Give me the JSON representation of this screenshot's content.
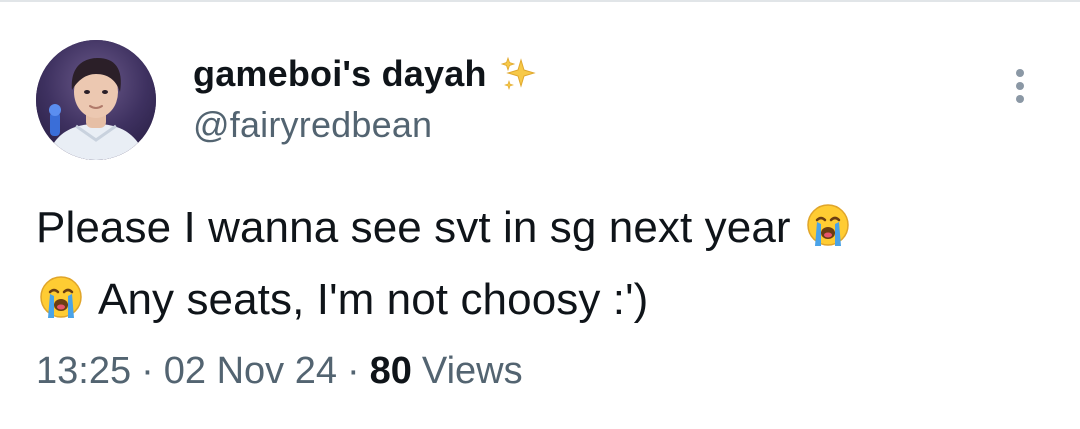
{
  "tweet": {
    "author": {
      "display_name": "gameboi's dayah",
      "name_emoji": "sparkles-icon",
      "handle": "@fairyredbean"
    },
    "text": {
      "line1": "Please I wanna see svt in sg next year",
      "line1_emoji": "loudly-crying-face-icon",
      "line2_emoji": "loudly-crying-face-icon",
      "line2": "Any seats, I'm not choosy :')"
    },
    "meta": {
      "time": "13:25",
      "separator": "·",
      "date": "02 Nov 24",
      "views_count": "80",
      "views_label": "Views"
    },
    "more_icon": "more-vertical-icon"
  },
  "colors": {
    "text_primary": "#0f1419",
    "text_secondary": "#536471",
    "icon_gray": "#8b98a5"
  }
}
